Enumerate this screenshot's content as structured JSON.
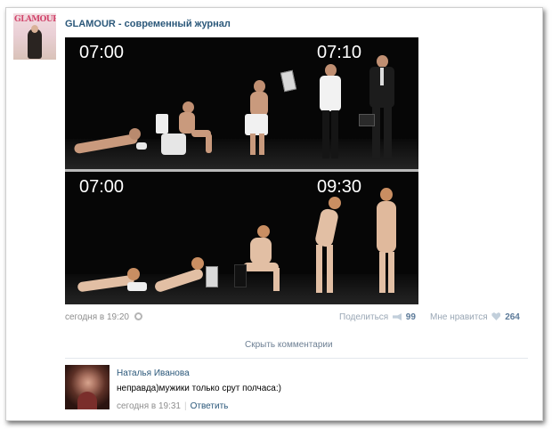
{
  "post": {
    "group_name": "GLAMOUR - современный журнал",
    "avatar_brand": "GLAMOUR",
    "photo": {
      "top_panel": {
        "time_left": "07:00",
        "time_right": "07:10"
      },
      "bottom_panel": {
        "time_left": "07:00",
        "time_right": "09:30"
      }
    },
    "date": "сегодня в 19:20",
    "share_label": "Поделиться",
    "share_count": "99",
    "like_label": "Мне нравится",
    "like_count": "264",
    "hide_comments": "Скрыть комментарии"
  },
  "comment": {
    "author": "Наталья Иванова",
    "text": "неправда)мужики только срут полчаса:)",
    "date": "сегодня в 19:31",
    "reply_label": "Ответить"
  },
  "colors": {
    "link": "#2b587a",
    "muted": "#8e8e8e",
    "photo_bg": "#060606"
  }
}
